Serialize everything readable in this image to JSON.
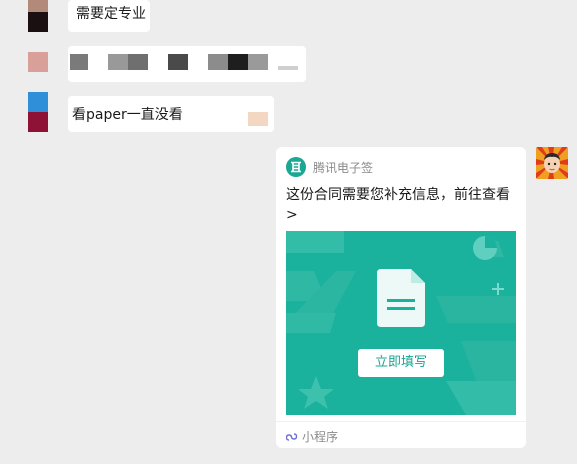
{
  "messages": [
    {
      "text": "需要定专业"
    },
    {
      "text": ""
    },
    {
      "text": "看paper一直没看"
    }
  ],
  "card": {
    "source_name": "腾讯电子签",
    "title": "这份合同需要您补充信息，前往查看 >",
    "button_label": "立即填写",
    "footer_label": "小程序"
  },
  "colors": {
    "banner": "#1ab19d",
    "brand": "#1aa794",
    "background": "#ededed"
  }
}
